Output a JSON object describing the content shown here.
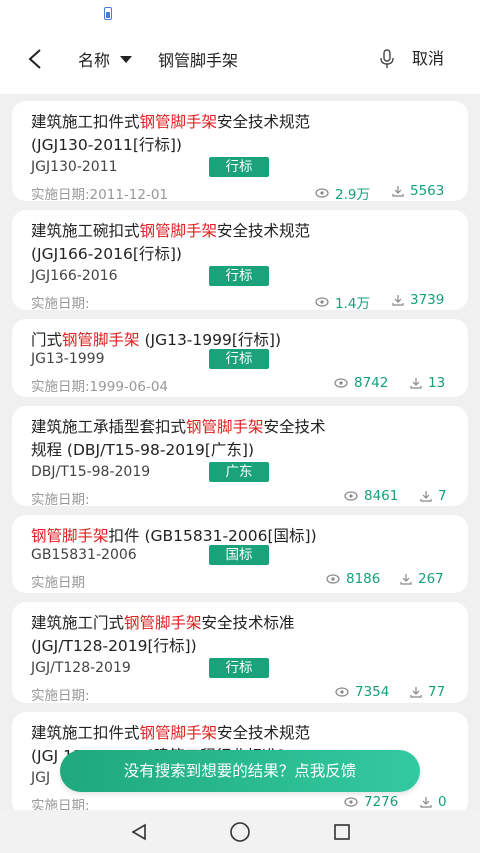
{
  "header": {
    "field_label": "名称",
    "search_value": "钢管脚手架"
  },
  "actions": {
    "cancel_label": "取消"
  },
  "results": [
    {
      "title_parts": [
        "建筑施工扣件式",
        "钢管脚手架",
        "安全技术规范"
      ],
      "title_line2": "(JGJ130-2011[行标])",
      "code": "JGJ130-2011",
      "badge": "行标",
      "date_label": "实施日期:2011-12-01",
      "views": "2.9万",
      "downloads": "5563"
    },
    {
      "title_parts": [
        "建筑施工碗扣式",
        "钢管脚手架",
        "安全技术规范"
      ],
      "title_line2": "(JGJ166-2016[行标])",
      "code": "JGJ166-2016",
      "badge": "行标",
      "date_label": "实施日期:",
      "views": "1.4万",
      "downloads": "3739"
    },
    {
      "title_parts": [
        "门式",
        "钢管脚手架",
        " (JG13-1999[行标])"
      ],
      "title_line2": "",
      "code": "JG13-1999",
      "badge": "行标",
      "date_label": "实施日期:1999-06-04",
      "views": "8742",
      "downloads": "13"
    },
    {
      "title_parts": [
        "建筑施工承插型套扣式",
        "钢管脚手架",
        "安全技术"
      ],
      "title_line2": "规程 (DBJ/T15-98-2019[广东])",
      "code": "DBJ/T15-98-2019",
      "badge": "广东",
      "date_label": "实施日期:",
      "views": "8461",
      "downloads": "7"
    },
    {
      "title_parts": [
        "",
        "钢管脚手架",
        "扣件 (GB15831-2006[国标])"
      ],
      "title_line2": "",
      "code": "GB15831-2006",
      "badge": "国标",
      "date_label": "实施日期",
      "views": "8186",
      "downloads": "267"
    },
    {
      "title_parts": [
        "建筑施工门式",
        "钢管脚手架",
        "安全技术标准"
      ],
      "title_line2": "(JGJ/T128-2019[行标])",
      "code": "JGJ/T128-2019",
      "badge": "行标",
      "date_label": "实施日期:",
      "views": "7354",
      "downloads": "77"
    },
    {
      "title_parts": [
        "建筑施工扣件式",
        "钢管脚手架",
        "安全技术规范"
      ],
      "title_line2": "(JGJ 130—2001[建筑工程行业标准]",
      "code": "JGJ",
      "badge": "",
      "date_label": "实施日期:",
      "views": "7276",
      "downloads": "0"
    }
  ],
  "feedback": {
    "label": "没有搜索到想要的结果？点我反馈"
  },
  "colors": {
    "accent": "#1aa37a",
    "highlight": "#e02020"
  }
}
